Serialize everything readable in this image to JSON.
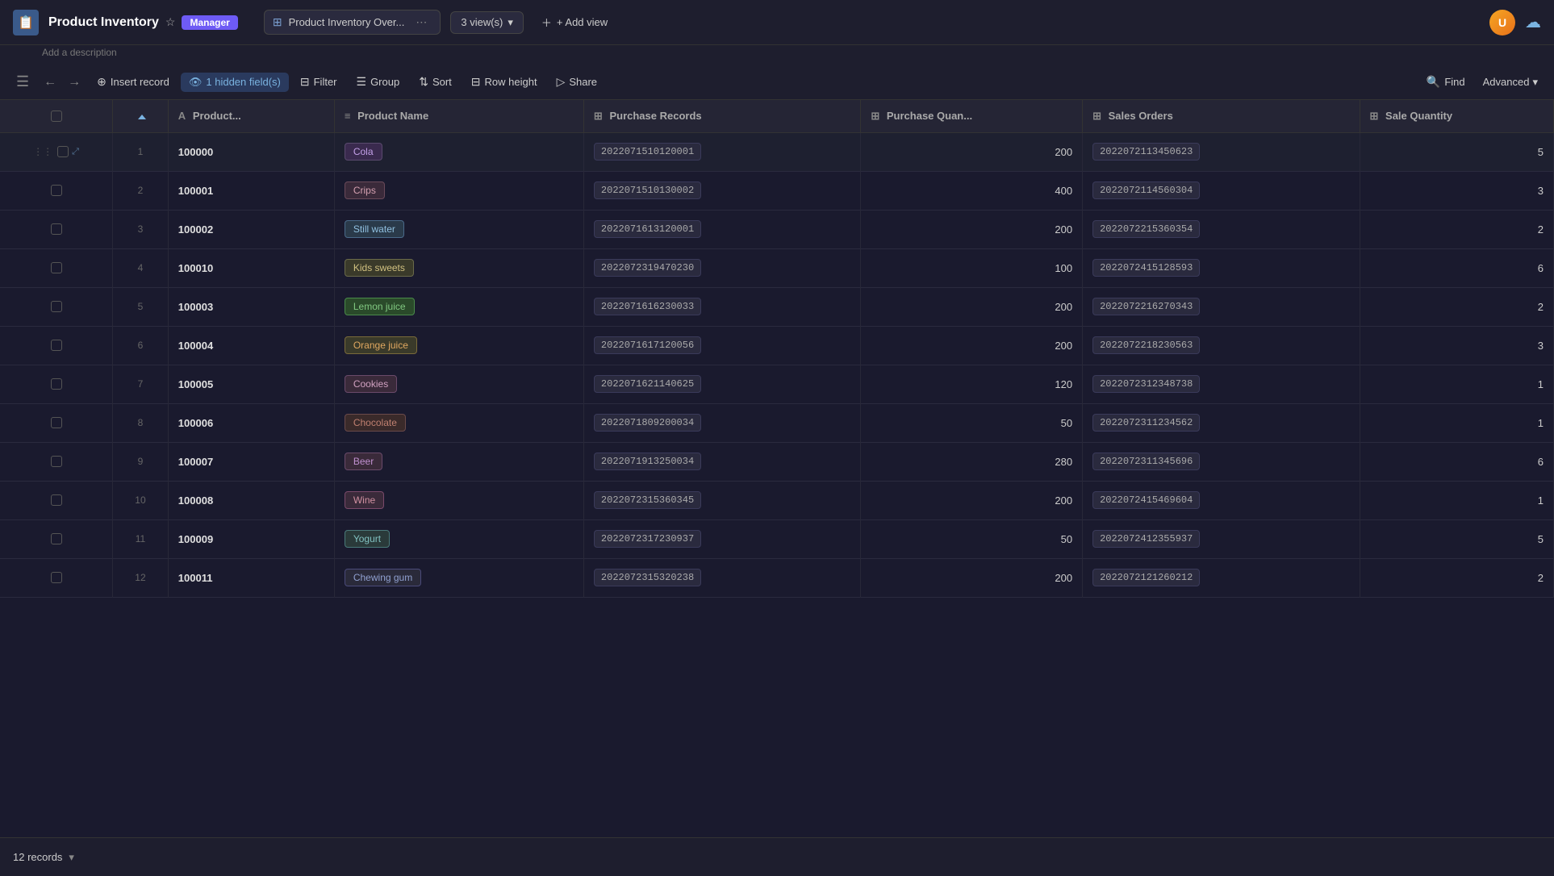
{
  "app": {
    "icon": "📋",
    "title": "Product Inventory",
    "subtitle": "Add a description",
    "badge": "Manager"
  },
  "header": {
    "view_tab_label": "Product Inventory Over...",
    "views_count": "3 view(s)",
    "add_view": "+ Add view",
    "find_label": "Find",
    "advanced_label": "Advanced"
  },
  "toolbar": {
    "insert_record": "Insert record",
    "hidden_fields": "1 hidden field(s)",
    "filter": "Filter",
    "group": "Group",
    "sort": "Sort",
    "row_height": "Row height",
    "share": "Share",
    "find": "Find",
    "advanced": "Advanced"
  },
  "table": {
    "columns": [
      {
        "id": "checkbox",
        "label": ""
      },
      {
        "id": "rownum",
        "label": ""
      },
      {
        "id": "productid",
        "label": "Product...",
        "icon": "A"
      },
      {
        "id": "productname",
        "label": "Product Name",
        "icon": "≡"
      },
      {
        "id": "purchaserecords",
        "label": "Purchase Records",
        "icon": "⊞"
      },
      {
        "id": "purchasequantity",
        "label": "Purchase Quan...",
        "icon": "⊞"
      },
      {
        "id": "salesorders",
        "label": "Sales Orders",
        "icon": "⊞"
      },
      {
        "id": "salequantity",
        "label": "Sale Quantity",
        "icon": "⊞"
      }
    ],
    "rows": [
      {
        "num": "1",
        "productid": "100000",
        "productname": "Cola",
        "tag_class": "tag-cola",
        "purchaserecords": "2022071510120001",
        "purchasequantity": "200",
        "salesorders": "2022072113450623",
        "salequantity": "5",
        "first": true
      },
      {
        "num": "2",
        "productid": "100001",
        "productname": "Crips",
        "tag_class": "tag-crips",
        "purchaserecords": "2022071510130002",
        "purchasequantity": "400",
        "salesorders": "2022072114560304",
        "salequantity": "3"
      },
      {
        "num": "3",
        "productid": "100002",
        "productname": "Still water",
        "tag_class": "tag-stillwater",
        "purchaserecords": "2022071613120001",
        "purchasequantity": "200",
        "salesorders": "2022072215360354",
        "salequantity": "2"
      },
      {
        "num": "4",
        "productid": "100010",
        "productname": "Kids sweets",
        "tag_class": "tag-kidssweets",
        "purchaserecords": "2022072319470230",
        "purchasequantity": "100",
        "salesorders": "2022072415128593",
        "salequantity": "6"
      },
      {
        "num": "5",
        "productid": "100003",
        "productname": "Lemon juice",
        "tag_class": "tag-lemonjuice",
        "purchaserecords": "2022071616230033",
        "purchasequantity": "200",
        "salesorders": "2022072216270343",
        "salequantity": "2"
      },
      {
        "num": "6",
        "productid": "100004",
        "productname": "Orange juice",
        "tag_class": "tag-orangejuice",
        "purchaserecords": "2022071617120056",
        "purchasequantity": "200",
        "salesorders": "2022072218230563",
        "salequantity": "3"
      },
      {
        "num": "7",
        "productid": "100005",
        "productname": "Cookies",
        "tag_class": "tag-cookies",
        "purchaserecords": "2022071621140625",
        "purchasequantity": "120",
        "salesorders": "2022072312348738",
        "salequantity": "1"
      },
      {
        "num": "8",
        "productid": "100006",
        "productname": "Chocolate",
        "tag_class": "tag-chocolate",
        "purchaserecords": "2022071809200034",
        "purchasequantity": "50",
        "salesorders": "2022072311234562",
        "salequantity": "1"
      },
      {
        "num": "9",
        "productid": "100007",
        "productname": "Beer",
        "tag_class": "tag-beer",
        "purchaserecords": "2022071913250034",
        "purchasequantity": "280",
        "salesorders": "2022072311345696",
        "salequantity": "6"
      },
      {
        "num": "10",
        "productid": "100008",
        "productname": "Wine",
        "tag_class": "tag-wine",
        "purchaserecords": "2022072315360345",
        "purchasequantity": "200",
        "salesorders": "2022072415469604",
        "salequantity": "1"
      },
      {
        "num": "11",
        "productid": "100009",
        "productname": "Yogurt",
        "tag_class": "tag-yogurt",
        "purchaserecords": "2022072317230937",
        "purchasequantity": "50",
        "salesorders": "2022072412355937",
        "salequantity": "5"
      },
      {
        "num": "12",
        "productid": "100011",
        "productname": "Chewing gum",
        "tag_class": "tag-chewinggum",
        "purchaserecords": "2022072315320238",
        "purchasequantity": "200",
        "salesorders": "2022072121260212",
        "salequantity": "2"
      }
    ]
  },
  "footer": {
    "records_count": "12 records",
    "dropdown_arrow": "▾"
  }
}
